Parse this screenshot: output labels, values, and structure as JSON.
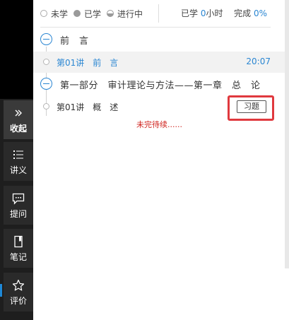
{
  "legend": {
    "not_started": "未学",
    "finished": "已学",
    "in_progress": "进行中"
  },
  "stats": {
    "studied_label": "已学",
    "studied_value": "0",
    "studied_unit": "小时",
    "complete_label": "完成",
    "complete_value": "0%"
  },
  "outline": {
    "sections": [
      {
        "title": "前　言",
        "lessons": [
          {
            "title": "第01讲　前　言",
            "time": "20:07"
          }
        ]
      },
      {
        "title": "第一部分　审计理论与方法——第一章　总　论",
        "lessons": [
          {
            "title": "第01讲　概　述",
            "exercise": "习题"
          }
        ]
      }
    ],
    "to_be_continued": "未完待续......"
  },
  "sidebar": {
    "collapse_label": "收起",
    "handout_label": "讲义",
    "question_label": "提问",
    "notes_label": "笔记",
    "rating_label": "评价"
  },
  "colors": {
    "accent": "#2a86d2",
    "highlight": "#e0393e",
    "sidebar_bg": "#2a2a2a"
  }
}
